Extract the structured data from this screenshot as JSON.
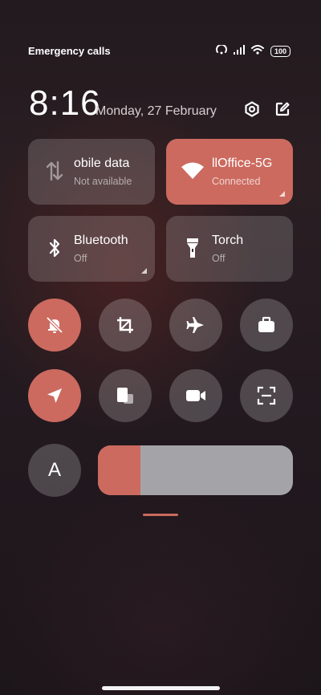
{
  "status_bar": {
    "carrier_text": "Emergency calls o",
    "battery": "100"
  },
  "header": {
    "time": "8:16",
    "date": "Monday, 27 February"
  },
  "tiles": [
    {
      "title": "obile data",
      "subtitle": "Not available",
      "active": false
    },
    {
      "title": "llOffice-5G",
      "subtitle": "Connected",
      "active": true
    },
    {
      "title": "Bluetooth",
      "subtitle": "Off",
      "active": false
    },
    {
      "title": "Torch",
      "subtitle": "Off",
      "active": false
    }
  ],
  "round_buttons": [
    {
      "name": "silent-mode-toggle",
      "icon": "bell-off-icon",
      "active": true
    },
    {
      "name": "crop-screenshot-toggle",
      "icon": "crop-icon",
      "active": false
    },
    {
      "name": "airplane-mode-toggle",
      "icon": "airplane-icon",
      "active": false
    },
    {
      "name": "work-mode-toggle",
      "icon": "briefcase-icon",
      "active": false
    },
    {
      "name": "location-toggle",
      "icon": "location-arrow-icon",
      "active": true
    },
    {
      "name": "floating-window-toggle",
      "icon": "floating-windows-icon",
      "active": false
    },
    {
      "name": "screen-record-toggle",
      "icon": "video-camera-icon",
      "active": false
    },
    {
      "name": "scanner-toggle",
      "icon": "scan-frame-icon",
      "active": false
    }
  ],
  "auto_brightness_label": "A",
  "brightness": {
    "level": 0.22
  },
  "colors": {
    "accent": "#cc6a5f",
    "tile_bg": "rgba(255,255,255,0.17)",
    "slider_bg": "#a4a4a8"
  }
}
